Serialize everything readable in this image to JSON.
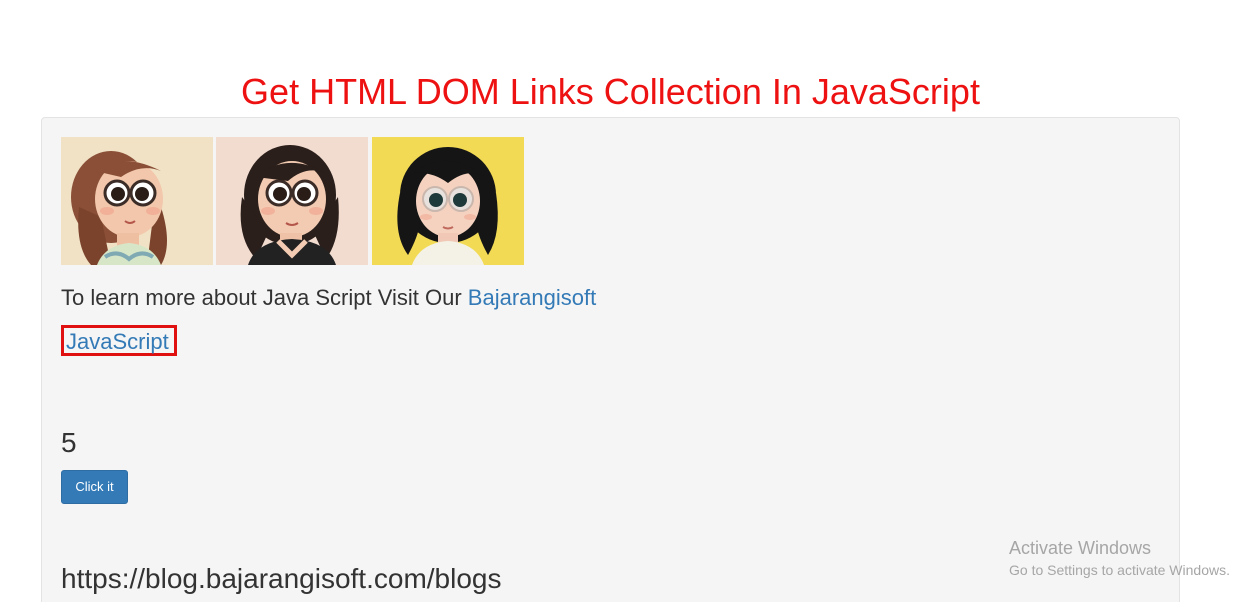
{
  "page": {
    "title": "Get HTML DOM Links Collection In JavaScript"
  },
  "images": [
    {
      "name": "avatar-girl-swimsuit",
      "bg": "#f1e2c6"
    },
    {
      "name": "avatar-girl-black-shirt",
      "bg": "#f2dcd0"
    },
    {
      "name": "avatar-girl-yellow-bg",
      "bg": "#f2da55"
    }
  ],
  "info": {
    "text": "To learn more about Java Script Visit Our ",
    "link_label": "Bajarangisoft"
  },
  "js_link": {
    "label": "JavaScript"
  },
  "result": {
    "count": "5",
    "button_label": "Click it",
    "url": "https://blog.bajarangisoft.com/blogs"
  },
  "watermark": {
    "title": "Activate Windows",
    "subtitle": "Go to Settings to activate Windows."
  },
  "colors": {
    "title": "#ee1111",
    "link": "#337ab7",
    "highlight_border": "#e01010",
    "button": "#337ab7",
    "well_bg": "#f5f5f5"
  }
}
